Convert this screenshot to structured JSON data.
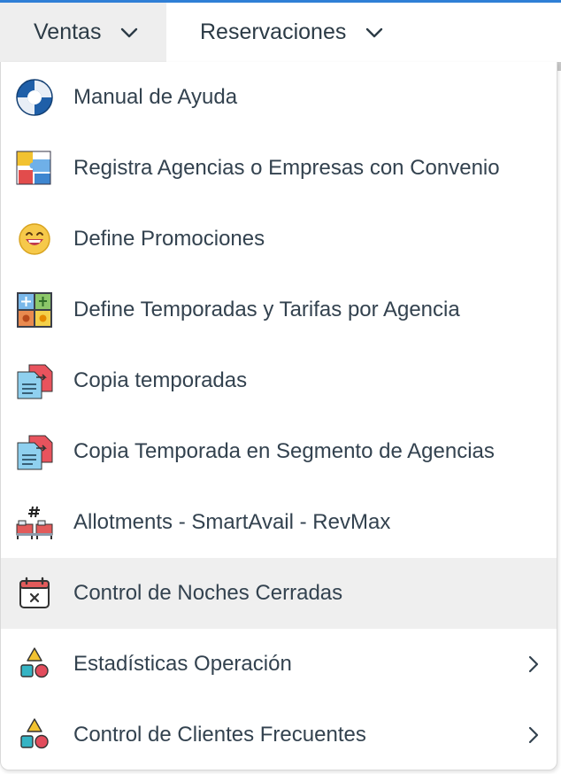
{
  "nav": {
    "ventas_label": "Ventas",
    "reservaciones_label": "Reservaciones"
  },
  "menu": {
    "items": [
      {
        "label": "Manual de Ayuda",
        "icon": "lifebuoy-icon"
      },
      {
        "label": "Registra Agencias o Empresas con Convenio",
        "icon": "puzzle-icon"
      },
      {
        "label": "Define Promociones",
        "icon": "smiley-icon"
      },
      {
        "label": "Define Temporadas y Tarifas por Agencia",
        "icon": "seasons-icon"
      },
      {
        "label": "Copia temporadas",
        "icon": "copy-document-icon"
      },
      {
        "label": "Copia Temporada en Segmento de Agencias",
        "icon": "copy-document-icon"
      },
      {
        "label": "Allotments - SmartAvail - RevMax",
        "icon": "beds-icon"
      },
      {
        "label": "Control de Noches Cerradas",
        "icon": "calendar-closed-icon"
      },
      {
        "label": "Estadísticas Operación",
        "icon": "shapes-icon"
      },
      {
        "label": "Control de Clientes Frecuentes",
        "icon": "shapes-icon"
      }
    ]
  },
  "colors": {
    "accent_topline": "#2f7fd6",
    "hover_bg": "#efefef",
    "text": "#33424f"
  }
}
